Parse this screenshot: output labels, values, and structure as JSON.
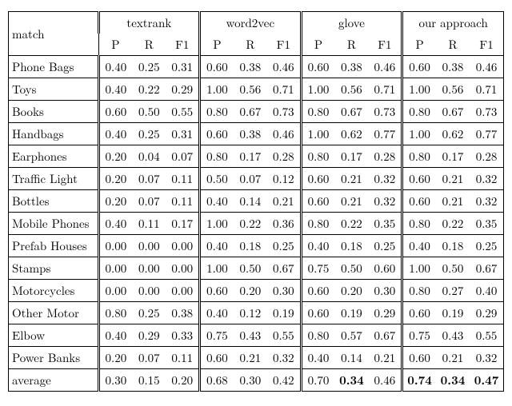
{
  "chart_data": {
    "type": "table",
    "header": {
      "corner": "match",
      "methods": [
        "textrank",
        "word2vec",
        "glove",
        "our approach"
      ],
      "metrics": [
        "P",
        "R",
        "F1"
      ]
    },
    "rows": [
      {
        "label": "Phone Bags",
        "textrank": {
          "P": "0.40",
          "R": "0.25",
          "F1": "0.31"
        },
        "word2vec": {
          "P": "0.60",
          "R": "0.38",
          "F1": "0.46"
        },
        "glove": {
          "P": "0.60",
          "R": "0.38",
          "F1": "0.46"
        },
        "ours": {
          "P": "0.60",
          "R": "0.38",
          "F1": "0.46"
        }
      },
      {
        "label": "Toys",
        "textrank": {
          "P": "0.40",
          "R": "0.22",
          "F1": "0.29"
        },
        "word2vec": {
          "P": "1.00",
          "R": "0.56",
          "F1": "0.71"
        },
        "glove": {
          "P": "1.00",
          "R": "0.56",
          "F1": "0.71"
        },
        "ours": {
          "P": "1.00",
          "R": "0.56",
          "F1": "0.71"
        }
      },
      {
        "label": "Books",
        "textrank": {
          "P": "0.60",
          "R": "0.50",
          "F1": "0.55"
        },
        "word2vec": {
          "P": "0.80",
          "R": "0.67",
          "F1": "0.73"
        },
        "glove": {
          "P": "0.80",
          "R": "0.67",
          "F1": "0.73"
        },
        "ours": {
          "P": "0.80",
          "R": "0.67",
          "F1": "0.73"
        }
      },
      {
        "label": "Handbags",
        "textrank": {
          "P": "0.40",
          "R": "0.25",
          "F1": "0.31"
        },
        "word2vec": {
          "P": "0.60",
          "R": "0.38",
          "F1": "0.46"
        },
        "glove": {
          "P": "1.00",
          "R": "0.62",
          "F1": "0.77"
        },
        "ours": {
          "P": "1.00",
          "R": "0.62",
          "F1": "0.77"
        }
      },
      {
        "label": "Earphones",
        "textrank": {
          "P": "0.20",
          "R": "0.04",
          "F1": "0.07"
        },
        "word2vec": {
          "P": "0.80",
          "R": "0.17",
          "F1": "0.28"
        },
        "glove": {
          "P": "0.80",
          "R": "0.17",
          "F1": "0.28"
        },
        "ours": {
          "P": "0.80",
          "R": "0.17",
          "F1": "0.28"
        }
      },
      {
        "label": "Traffic Light",
        "textrank": {
          "P": "0.20",
          "R": "0.07",
          "F1": "0.11"
        },
        "word2vec": {
          "P": "0.50",
          "R": "0.07",
          "F1": "0.12"
        },
        "glove": {
          "P": "0.60",
          "R": "0.21",
          "F1": "0.32"
        },
        "ours": {
          "P": "0.60",
          "R": "0.21",
          "F1": "0.32"
        }
      },
      {
        "label": "Bottles",
        "textrank": {
          "P": "0.20",
          "R": "0.07",
          "F1": "0.11"
        },
        "word2vec": {
          "P": "0.40",
          "R": "0.14",
          "F1": "0.21"
        },
        "glove": {
          "P": "0.60",
          "R": "0.21",
          "F1": "0.32"
        },
        "ours": {
          "P": "0.60",
          "R": "0.21",
          "F1": "0.32"
        }
      },
      {
        "label": "Mobile Phones",
        "textrank": {
          "P": "0.40",
          "R": "0.11",
          "F1": "0.17"
        },
        "word2vec": {
          "P": "1.00",
          "R": "0.22",
          "F1": "0.36"
        },
        "glove": {
          "P": "0.80",
          "R": "0.22",
          "F1": "0.35"
        },
        "ours": {
          "P": "0.80",
          "R": "0.22",
          "F1": "0.35"
        }
      },
      {
        "label": "Prefab Houses",
        "textrank": {
          "P": "0.00",
          "R": "0.00",
          "F1": "0.00"
        },
        "word2vec": {
          "P": "0.40",
          "R": "0.18",
          "F1": "0.25"
        },
        "glove": {
          "P": "0.40",
          "R": "0.18",
          "F1": "0.25"
        },
        "ours": {
          "P": "0.40",
          "R": "0.18",
          "F1": "0.25"
        }
      },
      {
        "label": "Stamps",
        "textrank": {
          "P": "0.00",
          "R": "0.00",
          "F1": "0.00"
        },
        "word2vec": {
          "P": "1.00",
          "R": "0.50",
          "F1": "0.67"
        },
        "glove": {
          "P": "0.75",
          "R": "0.50",
          "F1": "0.60"
        },
        "ours": {
          "P": "1.00",
          "R": "0.50",
          "F1": "0.67"
        }
      },
      {
        "label": "Motorcycles",
        "textrank": {
          "P": "0.00",
          "R": "0.00",
          "F1": "0.00"
        },
        "word2vec": {
          "P": "0.60",
          "R": "0.20",
          "F1": "0.30"
        },
        "glove": {
          "P": "0.60",
          "R": "0.20",
          "F1": "0.30"
        },
        "ours": {
          "P": "0.80",
          "R": "0.27",
          "F1": "0.40"
        }
      },
      {
        "label": "Other Motor",
        "textrank": {
          "P": "0.80",
          "R": "0.25",
          "F1": "0.38"
        },
        "word2vec": {
          "P": "0.40",
          "R": "0.12",
          "F1": "0.19"
        },
        "glove": {
          "P": "0.60",
          "R": "0.19",
          "F1": "0.29"
        },
        "ours": {
          "P": "0.60",
          "R": "0.19",
          "F1": "0.29"
        }
      },
      {
        "label": "Elbow",
        "textrank": {
          "P": "0.40",
          "R": "0.29",
          "F1": "0.33"
        },
        "word2vec": {
          "P": "0.75",
          "R": "0.43",
          "F1": "0.55"
        },
        "glove": {
          "P": "0.80",
          "R": "0.57",
          "F1": "0.67"
        },
        "ours": {
          "P": "0.75",
          "R": "0.43",
          "F1": "0.55"
        }
      },
      {
        "label": "Power Banks",
        "textrank": {
          "P": "0.20",
          "R": "0.07",
          "F1": "0.11"
        },
        "word2vec": {
          "P": "0.60",
          "R": "0.21",
          "F1": "0.32"
        },
        "glove": {
          "P": "0.40",
          "R": "0.14",
          "F1": "0.21"
        },
        "ours": {
          "P": "0.60",
          "R": "0.21",
          "F1": "0.32"
        }
      }
    ],
    "average": {
      "label": "average",
      "textrank": {
        "P": "0.30",
        "R": "0.15",
        "F1": "0.20"
      },
      "word2vec": {
        "P": "0.68",
        "R": "0.30",
        "F1": "0.42"
      },
      "glove": {
        "P": "0.70",
        "R": "0.34",
        "F1": "0.46",
        "bold": [
          "R"
        ]
      },
      "ours": {
        "P": "0.74",
        "R": "0.34",
        "F1": "0.47",
        "bold": [
          "P",
          "R",
          "F1"
        ]
      }
    }
  }
}
